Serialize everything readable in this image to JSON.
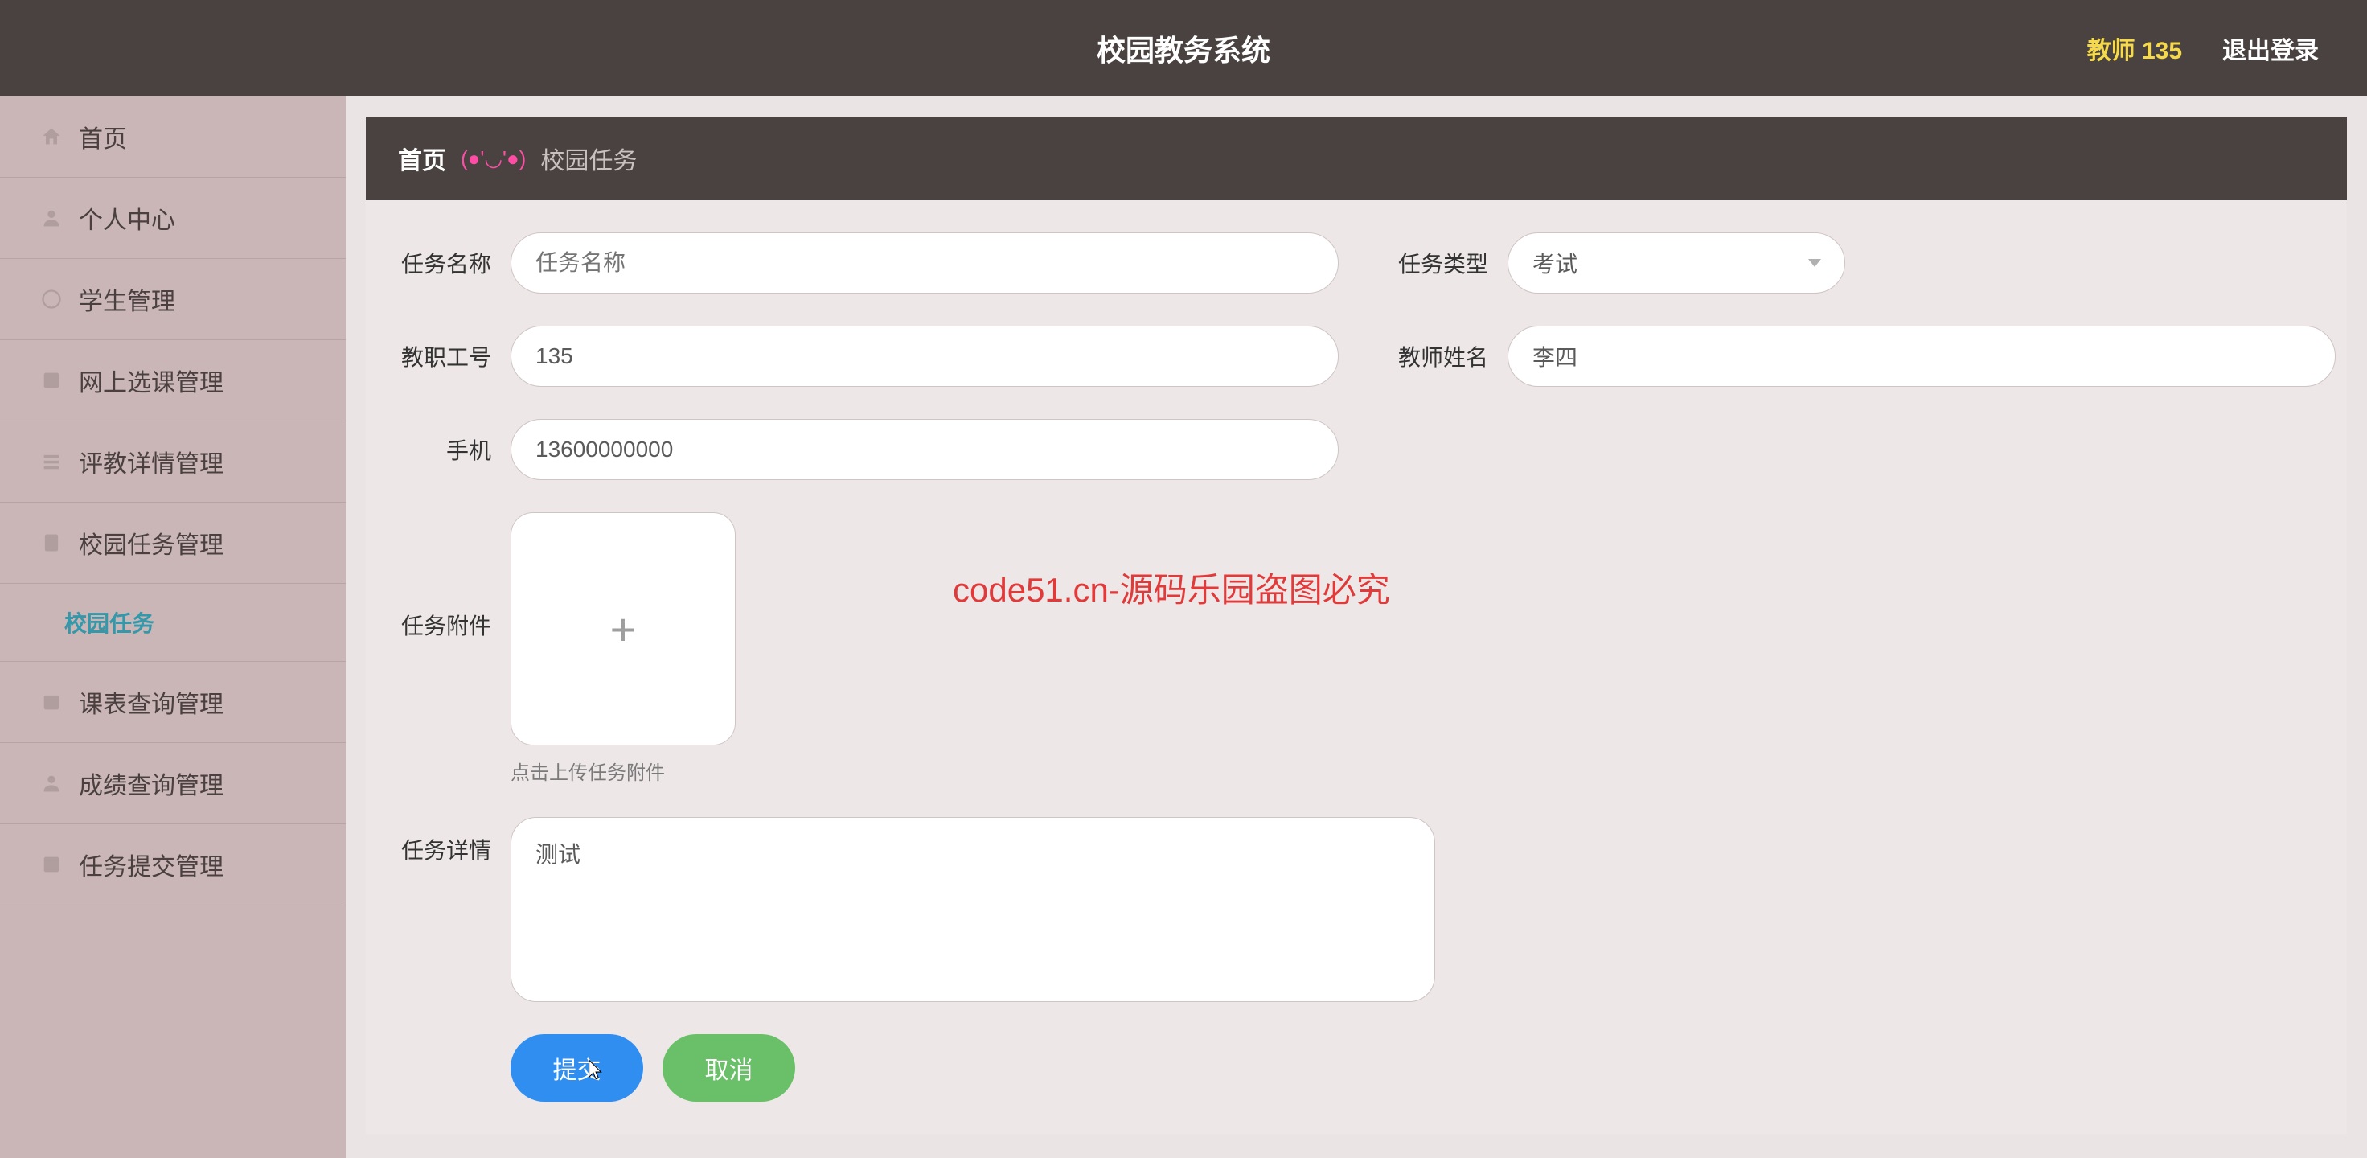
{
  "topbar": {
    "title": "校园教务系统",
    "user_label": "教师 135",
    "logout": "退出登录"
  },
  "sidebar": {
    "items": [
      {
        "label": "首页"
      },
      {
        "label": "个人中心"
      },
      {
        "label": "学生管理"
      },
      {
        "label": "网上选课管理"
      },
      {
        "label": "评教详情管理"
      },
      {
        "label": "校园任务管理"
      },
      {
        "label": "课表查询管理"
      },
      {
        "label": "成绩查询管理"
      },
      {
        "label": "任务提交管理"
      }
    ],
    "submenu_active": "校园任务"
  },
  "breadcrumb": {
    "home": "首页",
    "emoji": "(●'◡'●)",
    "current": "校园任务"
  },
  "form": {
    "task_name": {
      "label": "任务名称",
      "placeholder": "任务名称",
      "value": ""
    },
    "task_type": {
      "label": "任务类型",
      "value": "考试"
    },
    "staff_id": {
      "label": "教职工号",
      "value": "135"
    },
    "teacher_name": {
      "label": "教师姓名",
      "value": "李四"
    },
    "phone": {
      "label": "手机",
      "value": "13600000000"
    },
    "attachment": {
      "label": "任务附件",
      "hint": "点击上传任务附件"
    },
    "detail": {
      "label": "任务详情",
      "value": "测试"
    }
  },
  "buttons": {
    "submit": "提交",
    "cancel": "取消"
  },
  "watermark": "code51.cn-源码乐园盗图必究"
}
